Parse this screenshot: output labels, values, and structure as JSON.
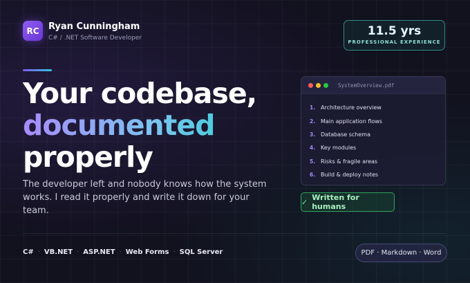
{
  "profile": {
    "initials": "RC",
    "name": "Ryan Cunningham",
    "role": "C# / .NET Software Developer"
  },
  "experience": {
    "value": "11.5 yrs",
    "label": "PROFESSIONAL EXPERIENCE"
  },
  "headline": {
    "line1": "Your codebase,",
    "line2": "documented",
    "line3": "properly"
  },
  "subtitle": "The developer left and nobody knows how the system works. I read it properly and write it down for your team.",
  "document_window": {
    "file_name": "SystemOverview.pdf",
    "items": [
      {
        "num": "1.",
        "label": "Architecture overview"
      },
      {
        "num": "2.",
        "label": "Main application flows"
      },
      {
        "num": "3.",
        "label": "Database schema"
      },
      {
        "num": "4.",
        "label": "Key modules"
      },
      {
        "num": "5.",
        "label": "Risks & fragile areas"
      },
      {
        "num": "6.",
        "label": "Build & deploy notes"
      }
    ]
  },
  "badge": {
    "icon": "check-icon",
    "check": "✓",
    "label": "Written for humans"
  },
  "tech_stack": {
    "items": [
      "C#",
      "VB.NET",
      "ASP.NET",
      "Web Forms",
      "SQL Server"
    ],
    "separator": "·"
  },
  "formats": "PDF · Markdown · Word",
  "colors": {
    "background": "#12111e",
    "accent_purple": "#8e5cf0",
    "accent_teal": "#2fd3d3",
    "badge_green": "#2fa35c"
  }
}
